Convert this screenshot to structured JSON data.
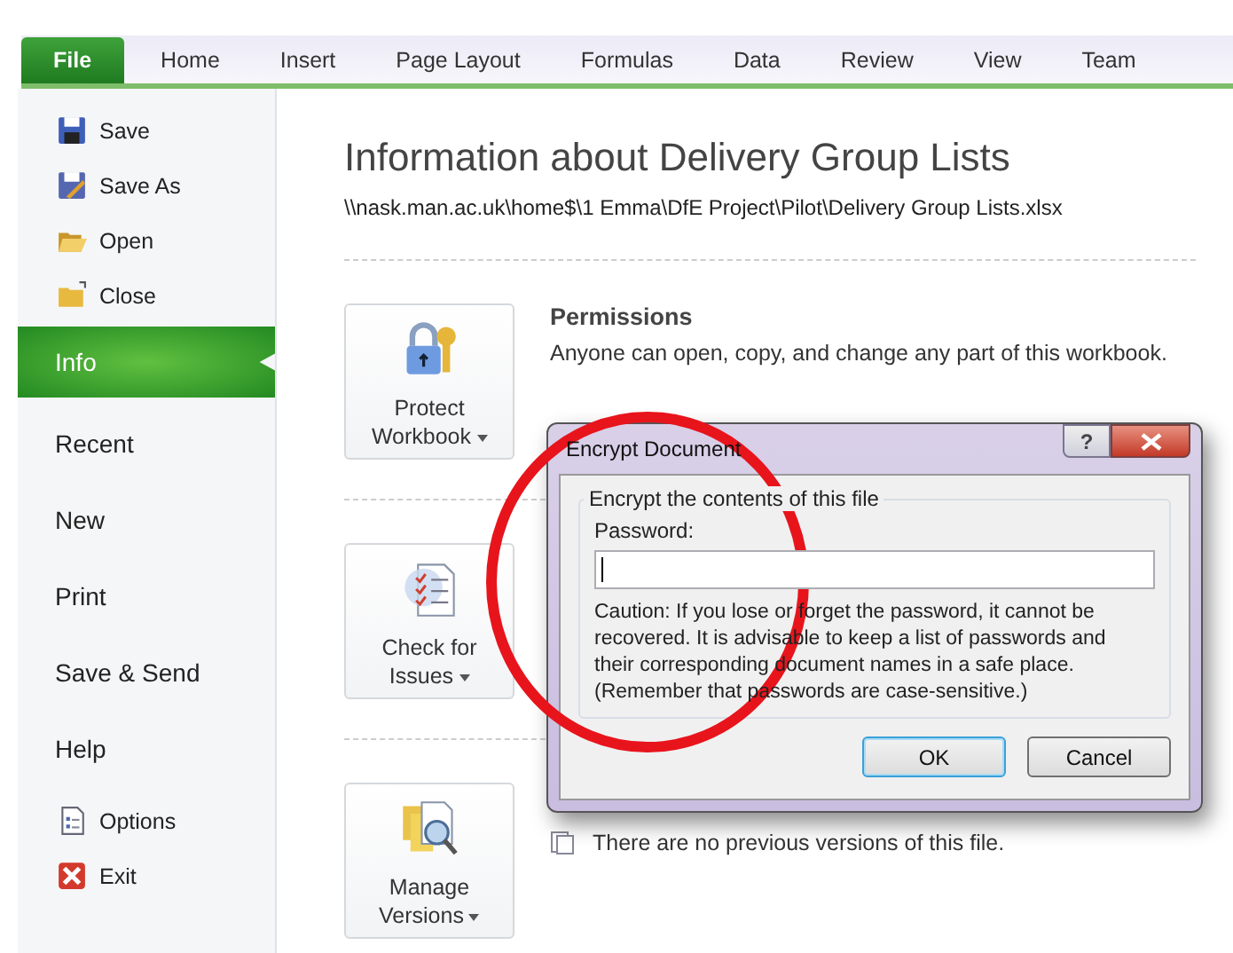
{
  "ribbon_tabs": [
    {
      "label": "File",
      "selected": true
    },
    {
      "label": "Home",
      "selected": false
    },
    {
      "label": "Insert",
      "selected": false
    },
    {
      "label": "Page Layout",
      "selected": false
    },
    {
      "label": "Formulas",
      "selected": false
    },
    {
      "label": "Data",
      "selected": false
    },
    {
      "label": "Review",
      "selected": false
    },
    {
      "label": "View",
      "selected": false
    },
    {
      "label": "Team",
      "selected": false
    }
  ],
  "backstage_menu": [
    {
      "label": "Save",
      "kind": "command",
      "selected": false
    },
    {
      "label": "Save As",
      "kind": "command",
      "selected": false
    },
    {
      "label": "Open",
      "kind": "command",
      "selected": false
    },
    {
      "label": "Close",
      "kind": "command",
      "selected": false
    },
    {
      "label": "Info",
      "kind": "page",
      "selected": true
    },
    {
      "label": "Recent",
      "kind": "page",
      "selected": false
    },
    {
      "label": "New",
      "kind": "page",
      "selected": false
    },
    {
      "label": "Print",
      "kind": "page",
      "selected": false
    },
    {
      "label": "Save & Send",
      "kind": "page",
      "selected": false
    },
    {
      "label": "Help",
      "kind": "page",
      "selected": false
    },
    {
      "label": "Options",
      "kind": "command",
      "selected": false
    },
    {
      "label": "Exit",
      "kind": "command",
      "selected": false
    }
  ],
  "info": {
    "title": "Information about Delivery Group Lists",
    "path": "\\\\nask.man.ac.uk\\home$\\1 Emma\\DfE Project\\Pilot\\Delivery Group Lists.xlsx",
    "sections": [
      {
        "button": "Protect Workbook",
        "heading": "Permissions",
        "description": "Anyone can open, copy, and change any part of this workbook."
      },
      {
        "button": "Check for Issues"
      },
      {
        "button": "Manage Versions",
        "description": "There are no previous versions of this file."
      }
    ]
  },
  "dialog": {
    "title": "Encrypt Document",
    "help": "?",
    "group_label": "Encrypt the contents of this file",
    "password_label": "Password:",
    "caution": "Caution: If you lose or forget the password, it cannot be recovered. It is advisable to keep a list of passwords and their corresponding document names in a safe place. (Remember that passwords are case-sensitive.)",
    "buttons": [
      {
        "label": "OK",
        "default": true
      },
      {
        "label": "Cancel",
        "default": false
      }
    ]
  }
}
